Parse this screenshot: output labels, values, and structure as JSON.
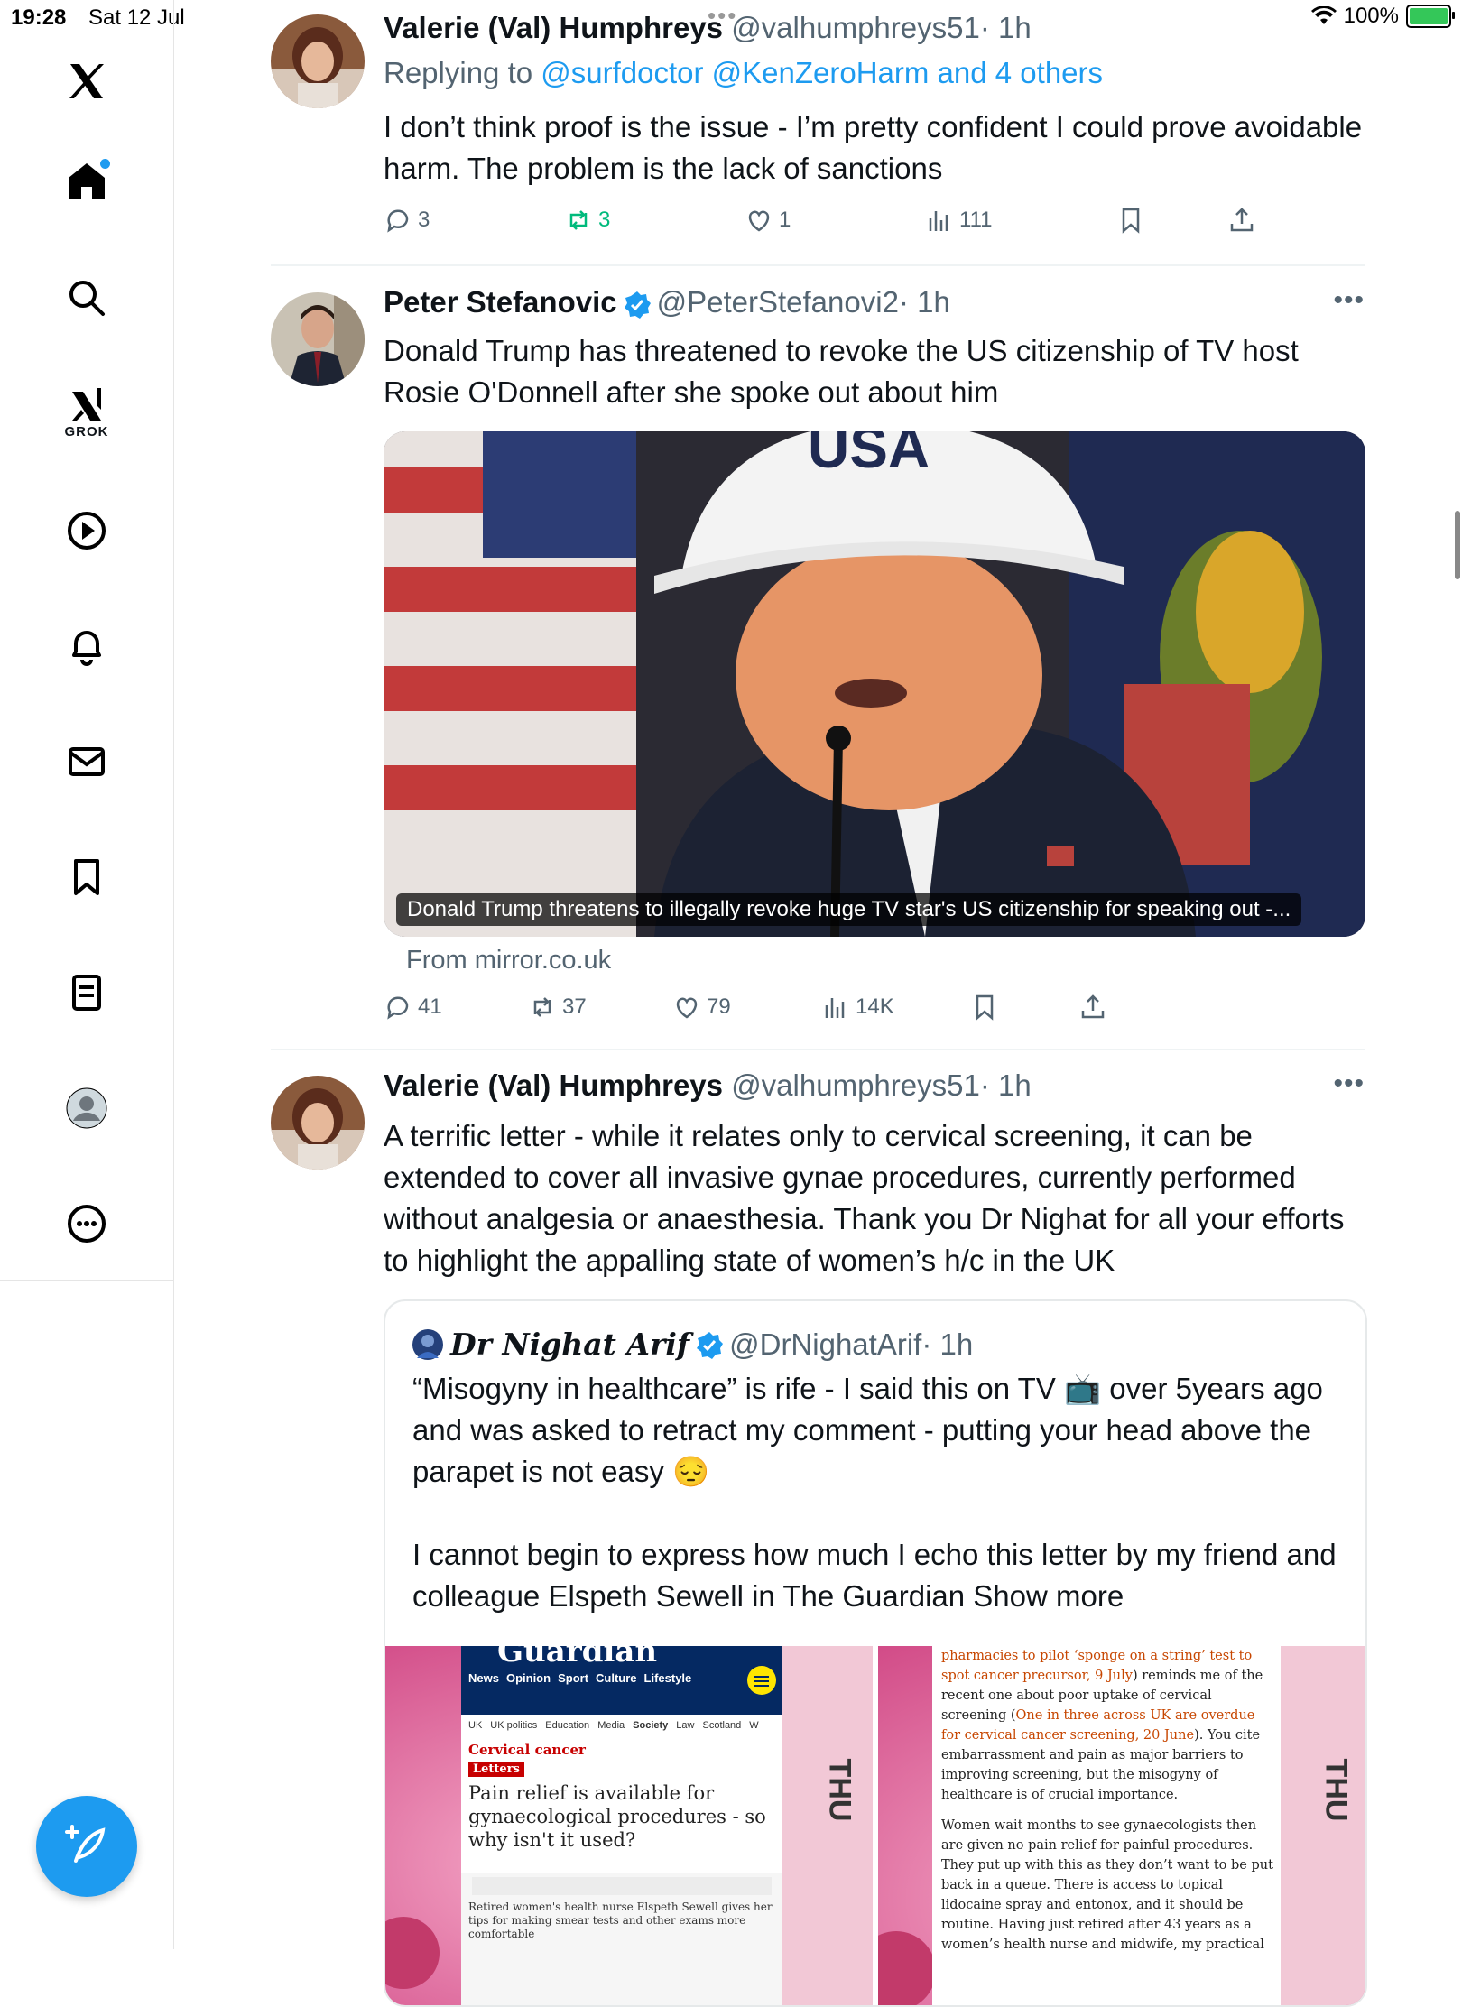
{
  "status": {
    "time": "19:28",
    "date": "Sat 12 Jul",
    "battery": "100%"
  },
  "sidebar": {
    "grok_label": "GROK",
    "items": [
      "home",
      "search",
      "grok",
      "video",
      "notifications",
      "messages",
      "bookmarks",
      "lists",
      "profile",
      "more"
    ]
  },
  "tweets": [
    {
      "name": "Valerie (Val) Humphreys",
      "handle": "@valhumphreys51",
      "time": "· 1h",
      "replying_prefix": "Replying to ",
      "replying_to": "@surfdoctor @KenZeroHarm and 4 others",
      "text": "I don’t think proof is the issue - I’m pretty confident I could prove avoidable harm. The problem is the lack of sanctions",
      "replies": "3",
      "reposts": "3",
      "likes": "1",
      "views": "111"
    },
    {
      "name": "Peter Stefanovic",
      "handle": "@PeterStefanovi2",
      "time": "· 1h",
      "text": "Donald Trump has threatened to revoke the US citizenship of TV host Rosie O'Donnell after she spoke out about him",
      "image_hat_text": "USA",
      "card_caption": "Donald Trump threatens to illegally revoke huge TV star's US citizenship for speaking out -...",
      "card_source": "From mirror.co.uk",
      "replies": "41",
      "reposts": "37",
      "likes": "79",
      "views": "14K"
    },
    {
      "name": "Valerie (Val) Humphreys",
      "handle": "@valhumphreys51",
      "time": "· 1h",
      "text": "A terrific letter - while it relates only to cervical screening, it can be extended to cover all invasive gynae procedures, currently performed without analgesia or anaesthesia. Thank you Dr Nighat for all your efforts to highlight the appalling state of women’s h/c in the UK",
      "quote": {
        "name": "Dr Nighat Arif",
        "handle": "@DrNighatArif",
        "time": "· 1h",
        "text1": "“Misogyny in healthcare” is rife - I said this on TV 📺 over 5years ago and was asked to retract my comment - putting your head above the parapet is not easy 😔",
        "text2": " I cannot begin to express how much I echo this letter by my friend and colleague Elspeth Sewell in The Guardian ",
        "show_more": "Show more",
        "img1": {
          "masthead": "Guardian",
          "nav": [
            "News",
            "Opinion",
            "Sport",
            "Culture",
            "Lifestyle"
          ],
          "subnav": [
            "UK",
            "UK politics",
            "Education",
            "Media",
            "Society",
            "Law",
            "Scotland",
            "W"
          ],
          "section": "Cervical cancer",
          "tag": "Letters",
          "headline": "Pain relief is available for gynaecological procedures - so why isn't it used?",
          "standfirst": "Retired women's health nurse Elspeth Sewell gives her tips for making smear tests and other exams more comfortable",
          "side": "THU"
        },
        "img2": {
          "p1_link": "pharmacies to pilot ‘sponge on a string’ test to spot cancer precursor, 9 July",
          "p1_a": ") reminds me of the recent one about poor uptake of cervical screening (",
          "p1_link2": "One in three across UK are overdue for cervical cancer screening, 20 June",
          "p1_b": "). You cite embarrassment and pain as major barriers to improving screening, but the misogyny of healthcare is of crucial importance.",
          "p2": "Women wait months to see gynaecologists then are given no pain relief for painful procedures. They put up with this as they don’t want to be put back in a queue. There is access to topical lidocaine spray and entonox, and it should be routine. Having just retired after 43 years as a women’s health nurse and midwife, my practical",
          "side": "THU"
        }
      }
    }
  ],
  "colors": {
    "accent": "#1d9bf0",
    "repost": "#00ba7c",
    "muted": "#536471"
  }
}
